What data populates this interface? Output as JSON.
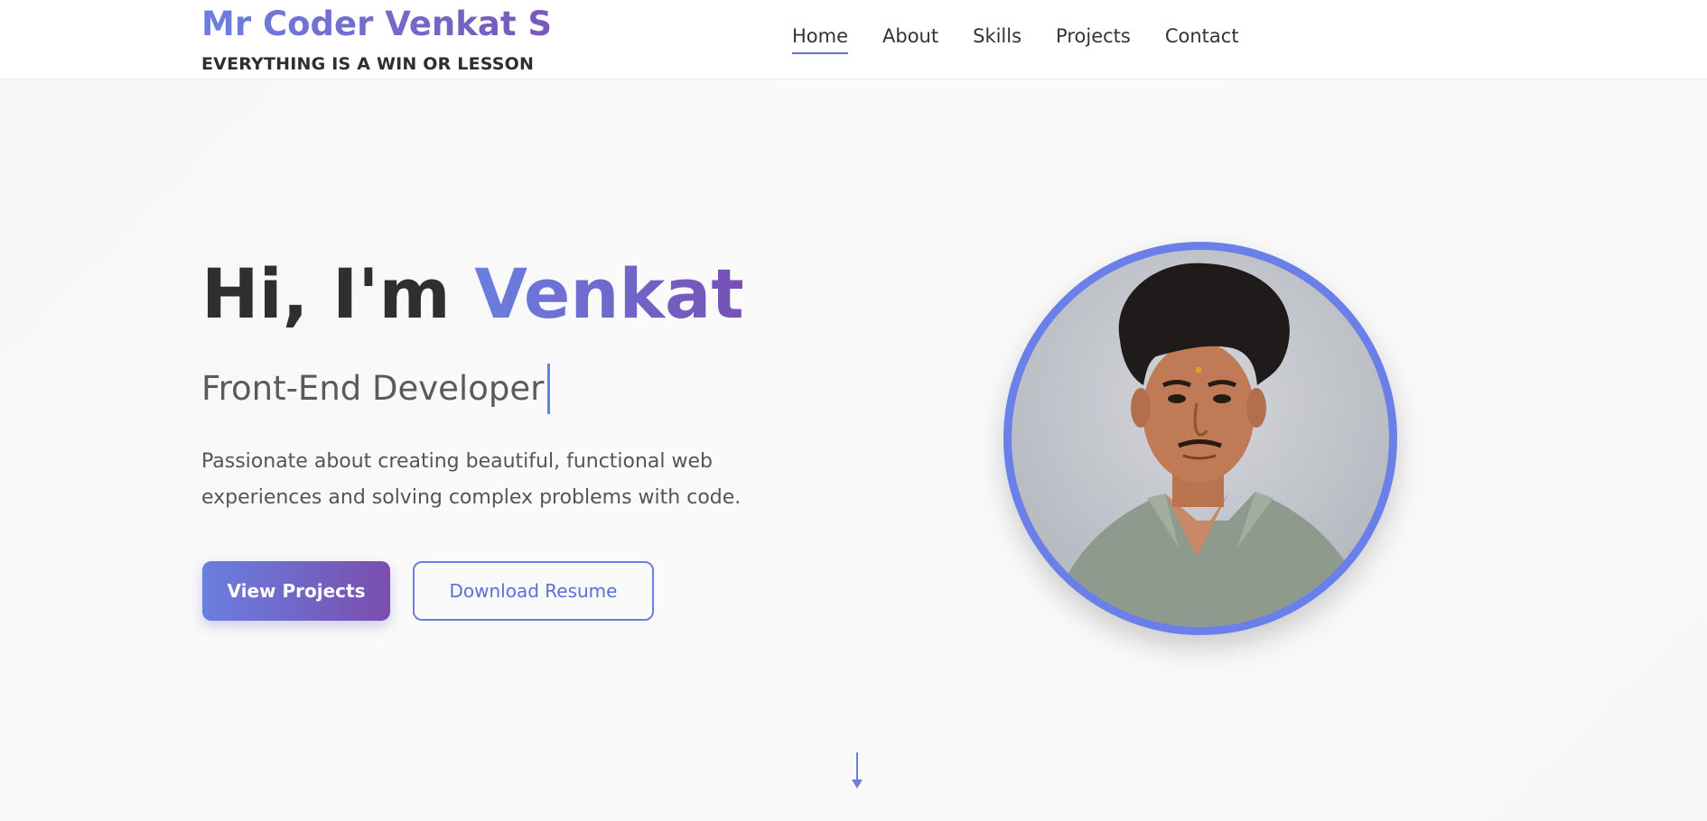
{
  "brand": {
    "name": "Mr Coder Venkat S",
    "tagline": "EVERYTHING IS A WIN OR LESSON"
  },
  "nav": {
    "items": [
      {
        "label": "Home",
        "active": true
      },
      {
        "label": "About",
        "active": false
      },
      {
        "label": "Skills",
        "active": false
      },
      {
        "label": "Projects",
        "active": false
      },
      {
        "label": "Contact",
        "active": false
      }
    ]
  },
  "hero": {
    "greeting": "Hi, I'm",
    "name": "Venkat",
    "role": "Front-End Developer",
    "description": "Passionate about creating beautiful, functional web experiences and solving complex problems with code.",
    "primary_button": "View Projects",
    "secondary_button": "Download Resume"
  },
  "icons": {
    "scroll": "arrow-down-icon"
  },
  "colors": {
    "accent": "#6a7fe0",
    "accent_purple": "#7651b6",
    "text_dark": "#2f2f2f"
  }
}
